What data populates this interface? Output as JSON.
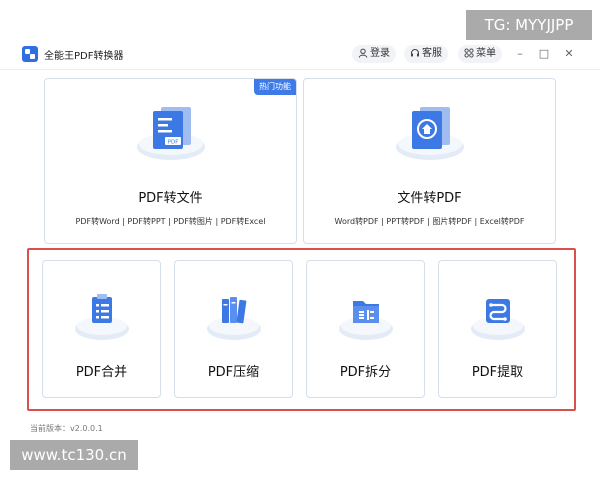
{
  "app": {
    "title": "全能王PDF转换器"
  },
  "toolbar": {
    "login": "登录",
    "service": "客服",
    "menu": "菜单"
  },
  "window_controls": {
    "minimize": "–",
    "maximize": "□",
    "close": "✕"
  },
  "cards_top": [
    {
      "title": "PDF转文件",
      "badge": "热门功能",
      "subs": "PDF转Word | PDF转PPT | PDF转图片 | PDF转Excel",
      "icon": "pdf-document-icon"
    },
    {
      "title": "文件转PDF",
      "subs": "Word转PDF | PPT转PDF | 图片转PDF | Excel转PDF",
      "icon": "convert-to-pdf-icon"
    }
  ],
  "cards_bottom": [
    {
      "title": "PDF合并",
      "icon": "clipboard-list-icon"
    },
    {
      "title": "PDF压缩",
      "icon": "compress-books-icon"
    },
    {
      "title": "PDF拆分",
      "icon": "folder-split-icon"
    },
    {
      "title": "PDF提取",
      "icon": "extract-path-icon"
    }
  ],
  "footer": {
    "version": "当前版本：v2.0.0.1"
  },
  "watermarks": {
    "top_right": "TG: MYYJJPP",
    "bottom_left": "www.tc130.cn"
  },
  "colors": {
    "accent": "#3f7be8",
    "highlight_border": "#d9504e",
    "card_border": "#d6deea"
  }
}
